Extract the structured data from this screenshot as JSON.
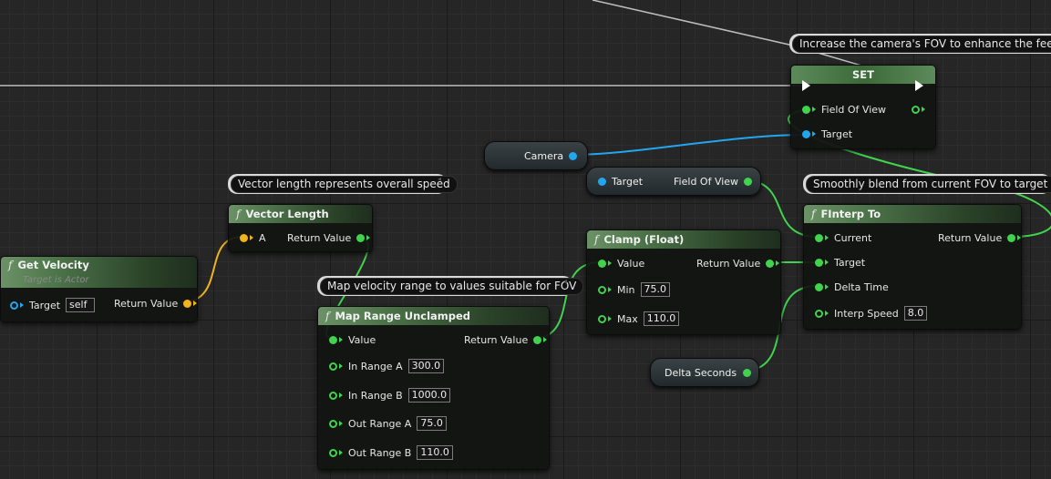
{
  "graph": {
    "comments": {
      "fov": "Increase the camera's FOV to enhance the feeling of",
      "speed": "Vector length represents overall speed",
      "map": "Map velocity range to values suitable for FOV",
      "blend": "Smoothly blend from current FOV to target FOV"
    },
    "set_node": {
      "title": "SET",
      "pin_fov": "Field Of View",
      "pin_target": "Target"
    },
    "camera_var": "Camera",
    "get_fov": {
      "target": "Target",
      "output": "Field Of View"
    },
    "get_velocity": {
      "title": "Get Velocity",
      "subtitle": "Target is Actor",
      "pin_target": "Target",
      "target_value": "self",
      "pin_return": "Return Value"
    },
    "vector_length": {
      "title": "Vector Length",
      "pin_a": "A",
      "pin_return": "Return Value"
    },
    "map_range": {
      "title": "Map Range Unclamped",
      "pin_value": "Value",
      "pin_return": "Return Value",
      "in_a_label": "In Range A",
      "in_a": "300.0",
      "in_b_label": "In Range B",
      "in_b": "1000.0",
      "out_a_label": "Out Range A",
      "out_a": "75.0",
      "out_b_label": "Out Range B",
      "out_b": "110.0"
    },
    "clamp": {
      "title": "Clamp (Float)",
      "pin_value": "Value",
      "pin_return": "Return Value",
      "min_label": "Min",
      "min": "75.0",
      "max_label": "Max",
      "max": "110.0"
    },
    "delta_seconds": "Delta Seconds",
    "finterp": {
      "title": "FInterp To",
      "pin_current": "Current",
      "pin_return": "Return Value",
      "pin_target": "Target",
      "pin_delta": "Delta Time",
      "pin_speed": "Interp Speed",
      "speed": "8.0"
    },
    "fn_glyph": "f",
    "colors": {
      "float": "#41d24e",
      "object": "#21a7f0",
      "vector": "#f0b31c",
      "exec": "#ffffff",
      "function_header": "#4b7248"
    }
  }
}
